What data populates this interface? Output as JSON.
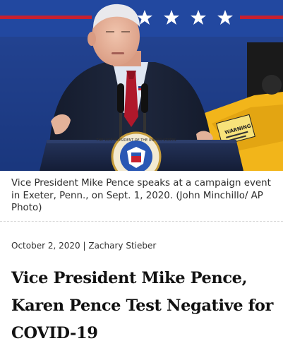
{
  "photo": {
    "alt_description": "",
    "warning_decal_text": "WARNING",
    "seal_text": "THE VICE PRESIDENT OF THE UNITED STATES"
  },
  "caption": "Vice President Mike Pence speaks at a campaign event in Exeter, Penn., on Sept. 1, 2020. (John Minchillo/ AP Photo)",
  "byline": {
    "date": "October 2, 2020",
    "separator": "|",
    "author": "Zachary Stieber"
  },
  "headline": "Vice President Mike Pence, Karen Pence Test Negative for COVID-19",
  "colors": {
    "backdrop_blue": "#1f3d8a",
    "banner_red": "#c8202f",
    "machine_yellow": "#f2b51a",
    "podium_navy": "#1c2a4a",
    "headline_text": "#111111",
    "caption_text": "#2e2e2e"
  }
}
